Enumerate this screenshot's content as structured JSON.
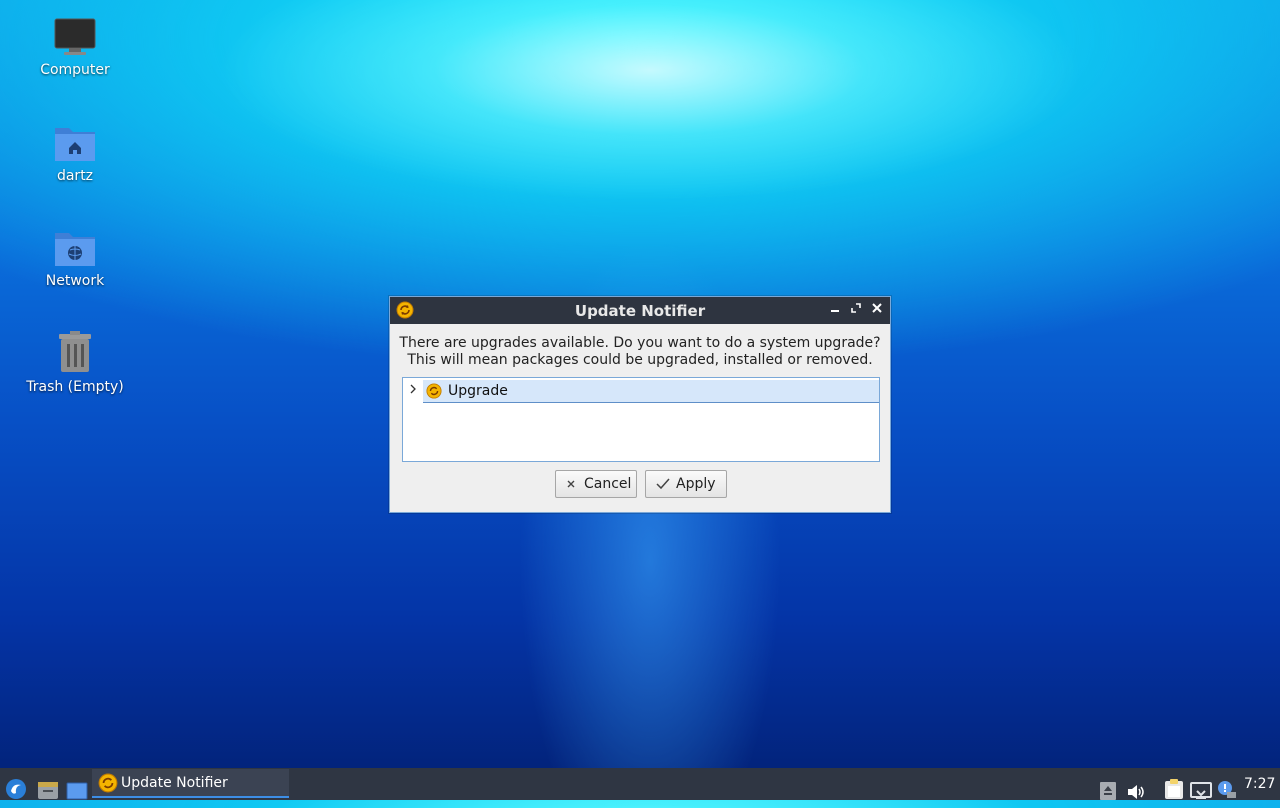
{
  "desktop": {
    "icons": [
      {
        "label": "Computer",
        "icon": "computer-icon"
      },
      {
        "label": "dartz",
        "icon": "home-folder-icon"
      },
      {
        "label": "Network",
        "icon": "network-folder-icon"
      },
      {
        "label": "Trash (Empty)",
        "icon": "trash-icon"
      }
    ]
  },
  "dialog": {
    "title": "Update Notifier",
    "message_line1": "There are upgrades available. Do you want to do a system upgrade?",
    "message_line2": "This will mean packages could be upgraded, installed or removed.",
    "tree": {
      "items": [
        {
          "label": "Upgrade",
          "expanded": false,
          "icon": "update-icon"
        }
      ]
    },
    "buttons": {
      "cancel": "Cancel",
      "apply": "Apply"
    }
  },
  "taskbar": {
    "launchers": [
      "start-menu-icon",
      "file-manager-icon",
      "show-desktop-icon"
    ],
    "tasks": [
      {
        "label": "Update Notifier",
        "icon": "update-icon",
        "active": true
      }
    ],
    "tray": [
      "eject-icon",
      "volume-icon",
      "clipboard-icon",
      "network-icon",
      "notification-icon"
    ],
    "clock": "7:27"
  },
  "colors": {
    "titlebar": "#2e3440",
    "taskbar": "#2f3643",
    "selection": "#d6e7fa",
    "accent": "#3d8ee6"
  }
}
